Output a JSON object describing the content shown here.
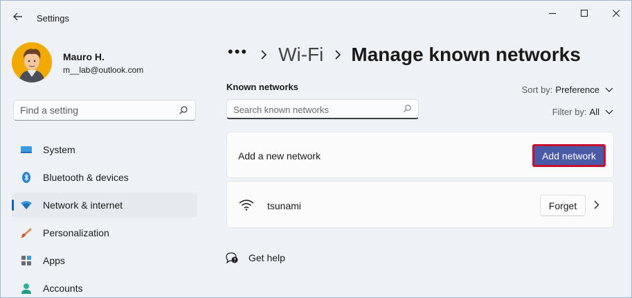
{
  "window": {
    "title": "Settings"
  },
  "user": {
    "name": "Mauro H.",
    "email": "m__lab@outlook.com"
  },
  "sidebar": {
    "search_placeholder": "Find a setting",
    "items": [
      {
        "label": "System",
        "icon": "system-icon"
      },
      {
        "label": "Bluetooth & devices",
        "icon": "bluetooth-icon"
      },
      {
        "label": "Network & internet",
        "icon": "network-icon",
        "active": true
      },
      {
        "label": "Personalization",
        "icon": "paintbrush-icon"
      },
      {
        "label": "Apps",
        "icon": "apps-icon"
      },
      {
        "label": "Accounts",
        "icon": "accounts-icon"
      }
    ]
  },
  "breadcrumb": {
    "ellipsis": "•••",
    "parent": "Wi-Fi",
    "current": "Manage known networks"
  },
  "known_networks": {
    "heading": "Known networks",
    "search_placeholder": "Search known networks",
    "sort_label": "Sort by:",
    "sort_value": "Preference",
    "filter_label": "Filter by:",
    "filter_value": "All"
  },
  "add_network": {
    "label": "Add a new network",
    "button": "Add network"
  },
  "networks": [
    {
      "name": "tsunami",
      "action": "Forget"
    }
  ],
  "help": {
    "label": "Get help"
  },
  "colors": {
    "accent": "#0067c0",
    "add_button": "#4a5aa6",
    "highlight_border": "#c8102e"
  }
}
